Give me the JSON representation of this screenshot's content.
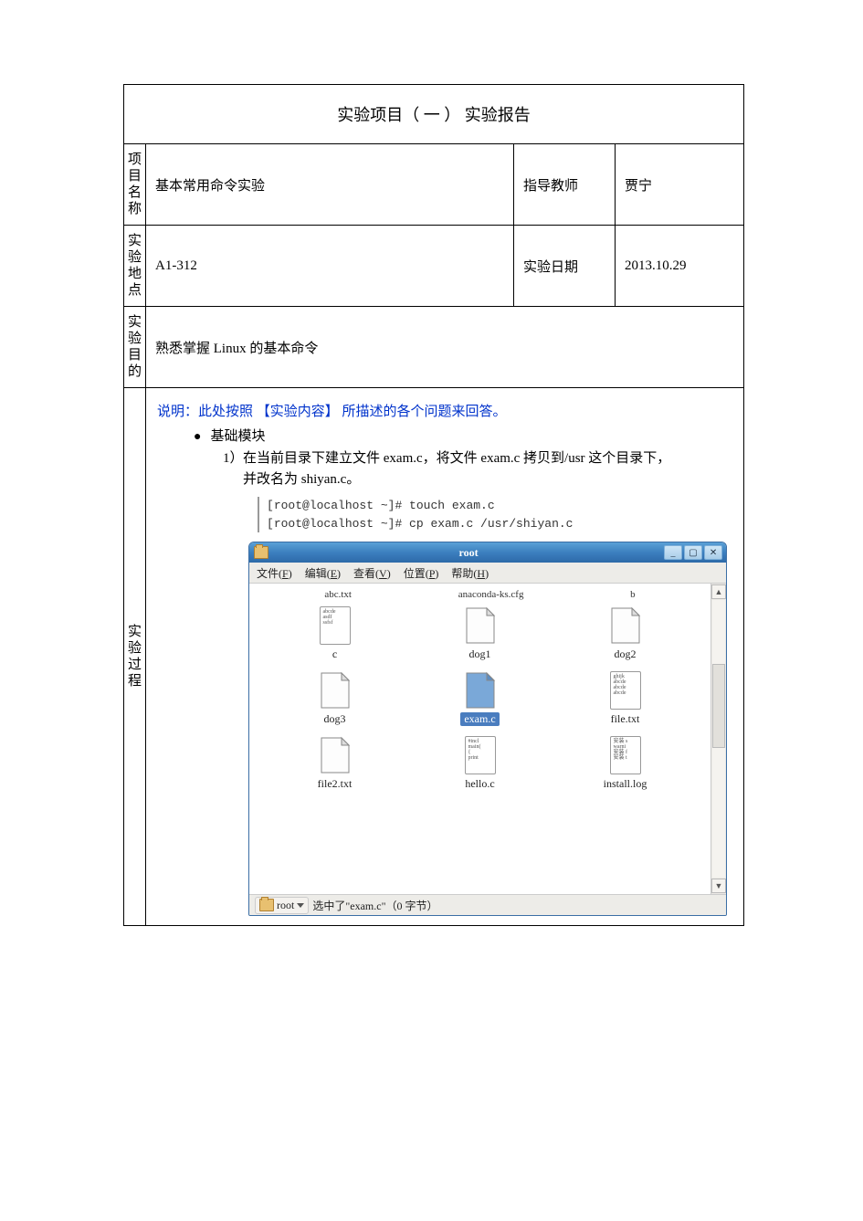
{
  "doc": {
    "title": "实验项目（ 一 ） 实验报告",
    "labels": {
      "project_name": "项目名称",
      "teacher_label": "指导教师",
      "location_label": "实验地点",
      "date_label": "实验日期",
      "objective_label": "实验目的",
      "process_label": "实验过程"
    },
    "values": {
      "project_name": "基本常用命令实验",
      "teacher": "贾宁",
      "location": "A1-312",
      "date": "2013.10.29",
      "objective": "熟悉掌握 Linux 的基本命令"
    },
    "process": {
      "note_prefix": "说明：此处按照 ",
      "note_bracket": "【实验内容】",
      "note_suffix": " 所描述的各个问题来回答。",
      "bullet": "●",
      "bullet_label": "基础模块",
      "item1_num": "1）",
      "item1_line1": "在当前目录下建立文件 exam.c，将文件 exam.c 拷贝到/usr  这个目录下，",
      "item1_line2": "并改名为  shiyan.c。",
      "term_line1": "[root@localhost ~]# touch exam.c",
      "term_line2": "[root@localhost ~]# cp exam.c /usr/shiyan.c"
    }
  },
  "fm": {
    "title": "root",
    "win_buttons": {
      "min": "_",
      "max": "▢",
      "close": "✕"
    },
    "menus": {
      "file": "文件(F)",
      "edit": "编辑(E)",
      "view": "查看(V)",
      "loc": "位置(P)",
      "help": "帮助(H)"
    },
    "cutoff_left": "abc.txt",
    "cutoff_mid": "anaconda-ks.cfg",
    "cutoff_right": "b",
    "files": [
      {
        "name": "c",
        "preview": "abcde\nasdf\nssfsf",
        "type": "txt"
      },
      {
        "name": "dog1",
        "type": "doc"
      },
      {
        "name": "dog2",
        "type": "doc"
      },
      {
        "name": "dog3",
        "type": "doc"
      },
      {
        "name": "exam.c",
        "type": "doc",
        "selected": true
      },
      {
        "name": "file.txt",
        "preview": "ghijk\nabcde\nabcde\nabcde",
        "type": "txt"
      },
      {
        "name": "file2.txt",
        "type": "doc"
      },
      {
        "name": "hello.c",
        "preview": "#incl\nmain(\n{\nprint",
        "type": "txt"
      },
      {
        "name": "install.log",
        "preview": "安装 s\nwarni\n安装 f\n安装 t",
        "type": "txt"
      }
    ],
    "status": {
      "loc": "root",
      "text": "选中了\"exam.c\"（0 字节）"
    }
  }
}
